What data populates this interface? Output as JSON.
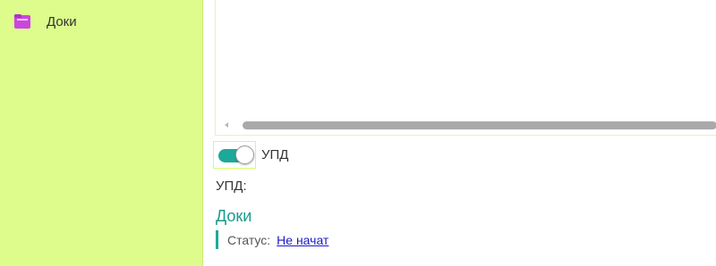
{
  "sidebar": {
    "items": [
      {
        "label": "Доки",
        "icon": "folder-icon",
        "icon_color": "#cc44e0"
      }
    ],
    "background": "#ddfc8c"
  },
  "main": {
    "toggle": {
      "label": "УПД",
      "state": "on",
      "color": "#1ca999"
    },
    "field": {
      "label": "УПД:"
    },
    "document": {
      "title": "Доки",
      "status_label": "Статус:",
      "status_value": "Не начат"
    }
  }
}
